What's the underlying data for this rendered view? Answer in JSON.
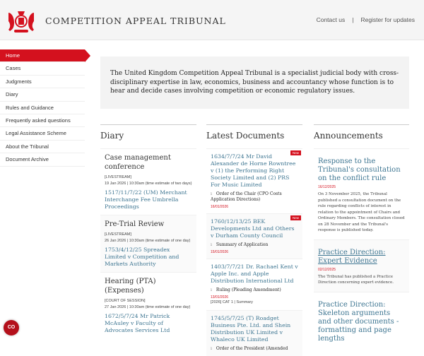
{
  "header": {
    "title": "COMPETITION APPEAL TRIBUNAL",
    "contact": "Contact us",
    "sep": "|",
    "register": "Register for updates"
  },
  "sidebar": {
    "items": [
      {
        "label": "Home"
      },
      {
        "label": "Cases"
      },
      {
        "label": "Judgments"
      },
      {
        "label": "Diary"
      },
      {
        "label": "Rules and Guidance"
      },
      {
        "label": "Frequently asked questions"
      },
      {
        "label": "Legal Assistance Scheme"
      },
      {
        "label": "About the Tribunal"
      },
      {
        "label": "Document Archive"
      }
    ]
  },
  "intro": "The United Kingdom Competition Appeal Tribunal is a specialist judicial body with cross-disciplinary expertise in law, economics, business and accountancy whose function is to hear and decide cases involving competition or economic regulatory issues.",
  "diary": {
    "heading": "Diary",
    "items": [
      {
        "title": "Case management conference",
        "tag": "[LIVESTREAM]",
        "when": "19 Jan 2026 | 10:30am (time estimate of two days)",
        "case": "1517/11/7/22 (UM) Merchant Interchange Fee Umbrella Proceedings"
      },
      {
        "title": "Pre-Trial Review",
        "tag": "[LIVESTREAM]",
        "when": "26 Jan 2026 | 10:30am (time estimate of one day)",
        "case": "1753/4/12/25 Spreadex Limited v Competition and Markets Authority"
      },
      {
        "title": "Hearing (PTA)(Expenses)",
        "tag": "[COURT OF SESSION]",
        "when": "27 Jan 2026 | 10:30am (time estimate of one day)",
        "case": "1672/5/7/24 Mr Patrick McAuley v Faculty of Advocates Services Ltd"
      }
    ]
  },
  "documents": {
    "heading": "Latest Documents",
    "new_label": "New",
    "items": [
      {
        "case": "1634/7/7/24 Mr David Alexander de Horne Rowntree v (1) the Performing Right Society Limited and (2) PRS For Music Limited",
        "type": "Order of the Chair (CPO Costs Application Directions)",
        "date": "16/01/2026",
        "new": true
      },
      {
        "case": "1760/12/13/25 BEK Developments Ltd and Others v Durham County Council",
        "type": "Summary of Application",
        "date": "15/01/2026",
        "new": true
      },
      {
        "case": "1403/7/7/21 Dr. Rachael Kent v Apple Inc. and Apple Distribution International Ltd",
        "type": "Ruling (Pleading Amendment)",
        "date": "13/01/2026",
        "extra": "[2026] CAT 1 | Summary",
        "new": false
      },
      {
        "case": "1745/5/7/25 (T) Roadget Business Pte. Ltd. and Shein Distribution UK Limited v Whaleco UK Limited",
        "type": "Order of the President (Amended",
        "new": false
      }
    ]
  },
  "announcements": {
    "heading": "Announcements",
    "items": [
      {
        "title": "Response to the Tribunal's consultation on the conflict rule",
        "date": "16/12/2025",
        "text": "On 3 November 2025, the Tribunal published a consultation document on the rule regarding conflicts of interest in relation to the appointment of Chairs and Ordinary Members. The consultation closed on 28 November and the Tribunal's response is published today."
      },
      {
        "title": "Practice Direction: Expert Evidence",
        "date": "02/12/2025",
        "text": "The Tribunal has published a Practice Direction concerning expert evidence."
      },
      {
        "title": "Practice Direction: Skeleton arguments and other documents - formatting and page lengths"
      }
    ]
  },
  "fab": "CO",
  "colors": {
    "accent": "#d4111e",
    "link": "#3d7591"
  }
}
